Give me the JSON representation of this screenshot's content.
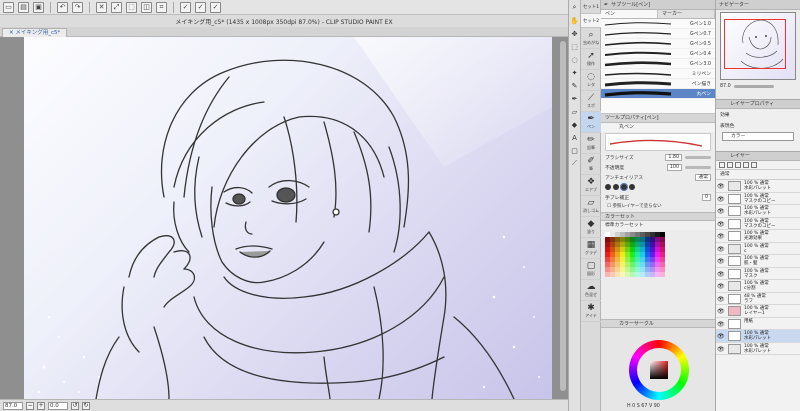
{
  "window": {
    "title": "メイキング用_c5* (1435 x 1008px 350dpi 87.0%) - CLIP STUDIO PAINT EX",
    "tab": "メイキング用_c5*"
  },
  "toolbar": {
    "icons": [
      "new-icon",
      "open-icon",
      "save-icon",
      "undo-icon",
      "redo-icon",
      "clear-icon",
      "transform-icon",
      "deselect-icon",
      "invert-icon",
      "crop-icon",
      "check-icon",
      "check-icon",
      "check-icon"
    ]
  },
  "statusbar": {
    "zoom": "87.0",
    "angle": "0.0"
  },
  "tool_tabs": {
    "sets": [
      "セット1",
      "セット2"
    ],
    "items": [
      {
        "label": "虫めがね",
        "icon": "zoom-icon"
      },
      {
        "label": "操作",
        "icon": "hand-icon"
      },
      {
        "label": "レタ",
        "icon": "lasso-icon"
      },
      {
        "label": "スポ",
        "icon": "eyedropper-icon"
      },
      {
        "label": "ペン",
        "icon": "pen-icon"
      },
      {
        "label": "鉛筆",
        "icon": "pencil-icon"
      },
      {
        "label": "筆",
        "icon": "brush-icon"
      },
      {
        "label": "エアブ",
        "icon": "airbrush-icon"
      },
      {
        "label": "消しゴム",
        "icon": "eraser-icon"
      },
      {
        "label": "塗り",
        "icon": "fill-icon"
      },
      {
        "label": "グラデ",
        "icon": "gradient-icon"
      },
      {
        "label": "図形",
        "icon": "shape-icon"
      },
      {
        "label": "色混ぜ",
        "icon": "blend-icon"
      },
      {
        "label": "アイテ",
        "icon": "item-icon"
      }
    ]
  },
  "subtool": {
    "title": "サブツール[ペン]",
    "tabs": [
      "ペン",
      "マーカー"
    ],
    "brushes": [
      "Gペン1.0",
      "Gペン0.7",
      "Gペン0.5",
      "Gペン0.4",
      "Gペン3.0",
      "ミリペン",
      "ペン描き",
      "丸ペン"
    ],
    "selected_brush": 7
  },
  "tool_property": {
    "header": "ツールプロパティ[ペン]",
    "title": "丸ペン",
    "brush_size_label": "ブラシサイズ",
    "brush_size": "1.80",
    "opacity_label": "不透明度",
    "opacity": "100",
    "aa_label": "アンチエイリアス",
    "aa_mode": "通常",
    "stabilize_label": "手ブレ補正",
    "stabilize": "0",
    "check_label": "参照レイヤーで塗らない"
  },
  "color_set": {
    "header": "カラーセット",
    "set_name": "標準カラーセット"
  },
  "color_circle": {
    "header": "カラーサークル",
    "h": "H 0",
    "s": "S 67",
    "v": "V 90"
  },
  "navigator": {
    "title": "ナビゲーター",
    "zoom": "87.0"
  },
  "layer_property": {
    "title": "レイヤープロパティ",
    "effect_label": "効果",
    "color_label": "表現色",
    "color_mode": "カラー"
  },
  "layers": {
    "title": "レイヤー",
    "blend": "通常",
    "rows": [
      {
        "name": "100 %  通常\n水彩パレット",
        "type": "folder"
      },
      {
        "name": "100 %  通常\nマスクのコピー",
        "type": "layer"
      },
      {
        "name": "100 %  通常\n水彩パレット",
        "type": "layer"
      },
      {
        "name": "100 %  通常\nマスクのコピー",
        "type": "layer"
      },
      {
        "name": "100 %  通常\n光源効果",
        "type": "layer"
      },
      {
        "name": "100 %  通常\nc",
        "type": "folder"
      },
      {
        "name": "100 %  通常\n肌・髪",
        "type": "layer"
      },
      {
        "name": "100 %  通常\nマスク",
        "type": "layer"
      },
      {
        "name": "100 %  通常\nc分割",
        "type": "folder"
      },
      {
        "name": "48 %  通常\nラフ",
        "type": "layer"
      },
      {
        "name": "100 %  通常\nレイヤー1",
        "type": "pink"
      },
      {
        "name": "用紙",
        "type": "layer"
      },
      {
        "name": "100 %  通常\n水彩パレット",
        "type": "layer"
      },
      {
        "name": "100 %  通常\n水彩パレット",
        "type": "folder"
      }
    ]
  }
}
